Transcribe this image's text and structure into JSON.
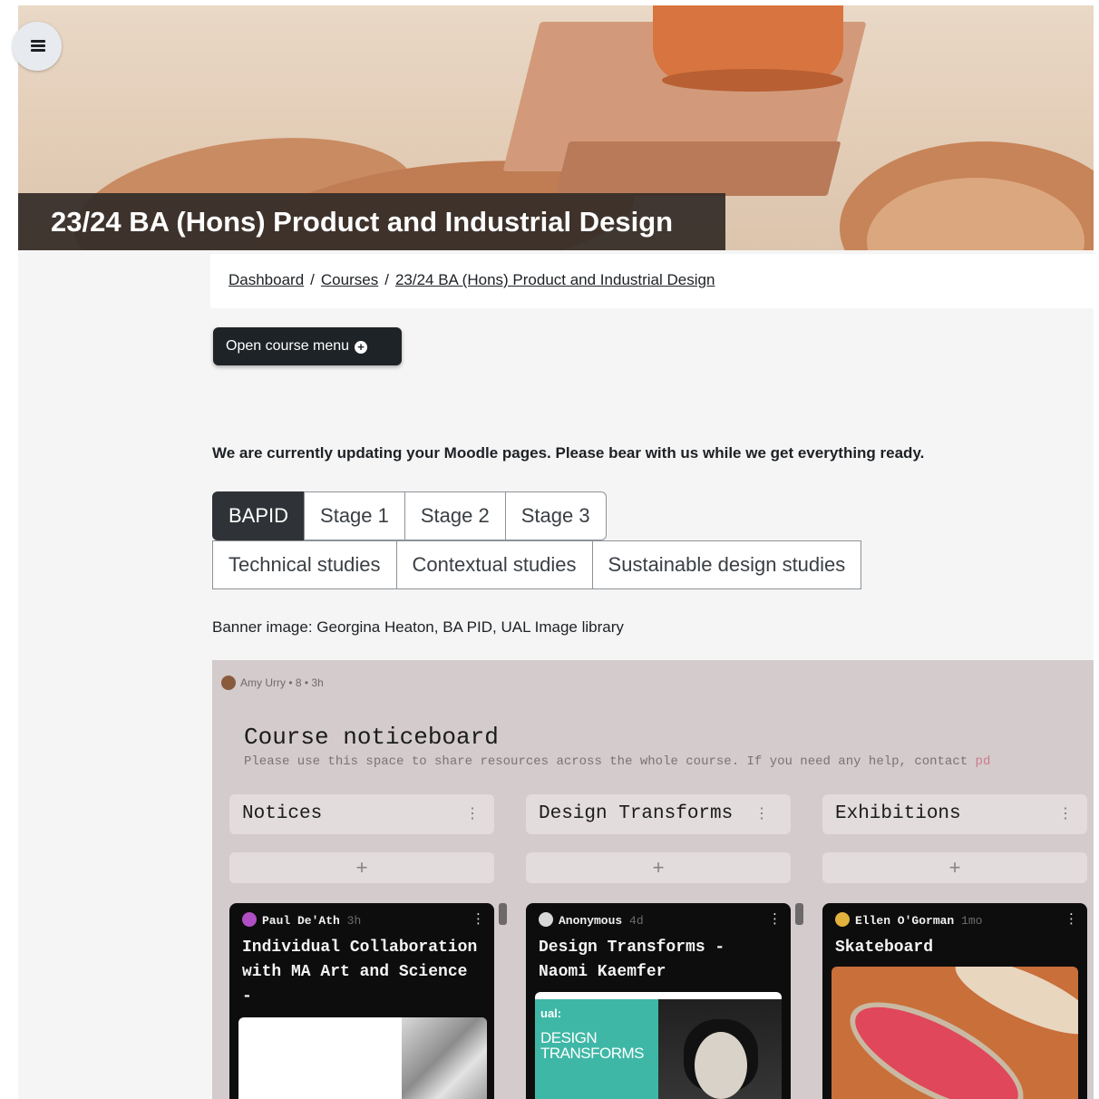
{
  "course": {
    "title": "23/24 BA (Hons) Product and Industrial Design"
  },
  "breadcrumb": {
    "items": [
      "Dashboard",
      "Courses",
      "23/24 BA (Hons) Product and Industrial Design"
    ],
    "separator": "/"
  },
  "course_menu": {
    "label": "Open course menu"
  },
  "notice": "We are currently updating your Moodle pages. Please bear with us while we get everything ready.",
  "tabs": {
    "row1": [
      {
        "label": "BAPID",
        "active": true
      },
      {
        "label": "Stage 1",
        "active": false
      },
      {
        "label": "Stage 2",
        "active": false
      },
      {
        "label": "Stage 3",
        "active": false
      }
    ],
    "row2": [
      {
        "label": "Technical studies"
      },
      {
        "label": "Contextual studies"
      },
      {
        "label": "Sustainable design studies"
      }
    ]
  },
  "credit": "Banner image: Georgina Heaton, BA PID, UAL Image library",
  "padlet": {
    "author": "Amy Urry",
    "author_meta": "• 8 • 3h",
    "title": "Course noticeboard",
    "description": "Please use this space to share resources across the whole course. If you need any help, contact",
    "description_tail": "pd",
    "add_symbol": "+",
    "columns": [
      {
        "name": "Notices",
        "card": {
          "author": "Paul De'Ath",
          "ago": "3h",
          "title": "Individual Collaboration with MA Art and Science -"
        }
      },
      {
        "name": "Design Transforms",
        "card": {
          "author": "Anonymous",
          "ago": "4d",
          "title": "Design Transforms - Naomi Kaemfer",
          "image_brand": "ual:",
          "image_text": "DESIGN TRANSFORMS"
        }
      },
      {
        "name": "Exhibitions",
        "card": {
          "author": "Ellen O'Gorman",
          "ago": "1mo",
          "title": "Skateboard"
        }
      }
    ]
  },
  "colors": {
    "title_bar": "#342c28",
    "button_dark": "#1e2327",
    "padlet_bg": "#d3cbcc",
    "card_bg": "#0d0d0d",
    "tab_active": "#2f3337"
  },
  "icons": {
    "drawer": "drawer-toggle-icon",
    "course_menu": "plus-circle-icon",
    "kebab": "kebab-icon"
  }
}
